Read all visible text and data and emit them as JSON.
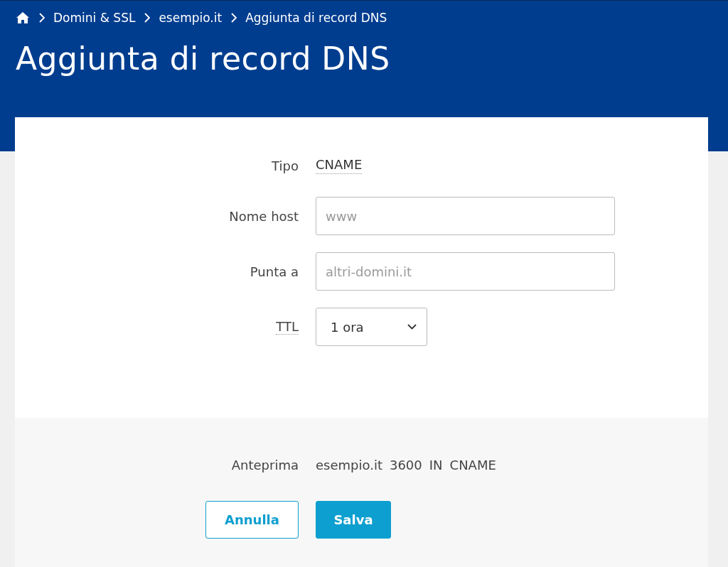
{
  "breadcrumb": [
    {
      "label": "Domini & SSL"
    },
    {
      "label": "esempio.it"
    },
    {
      "label": "Aggiunta di record DNS"
    }
  ],
  "title": "Aggiunta di record DNS",
  "fields": [
    {
      "kind": "static",
      "label": "Tipo",
      "label_tooltip": false,
      "value": "CNAME"
    },
    {
      "kind": "text",
      "label": "Nome host",
      "label_tooltip": false,
      "placeholder": "www"
    },
    {
      "kind": "text",
      "label": "Punta a",
      "label_tooltip": false,
      "placeholder": "altri-domini.it"
    },
    {
      "kind": "select",
      "label": "TTL",
      "label_tooltip": true,
      "value": "1 ora"
    }
  ],
  "preview": {
    "label": "Anteprima",
    "parts": [
      "esempio.it",
      "3600",
      "IN",
      "CNAME"
    ]
  },
  "buttons": [
    {
      "label": "Annulla",
      "kind": "secondary"
    },
    {
      "label": "Salva",
      "kind": "primary"
    }
  ]
}
